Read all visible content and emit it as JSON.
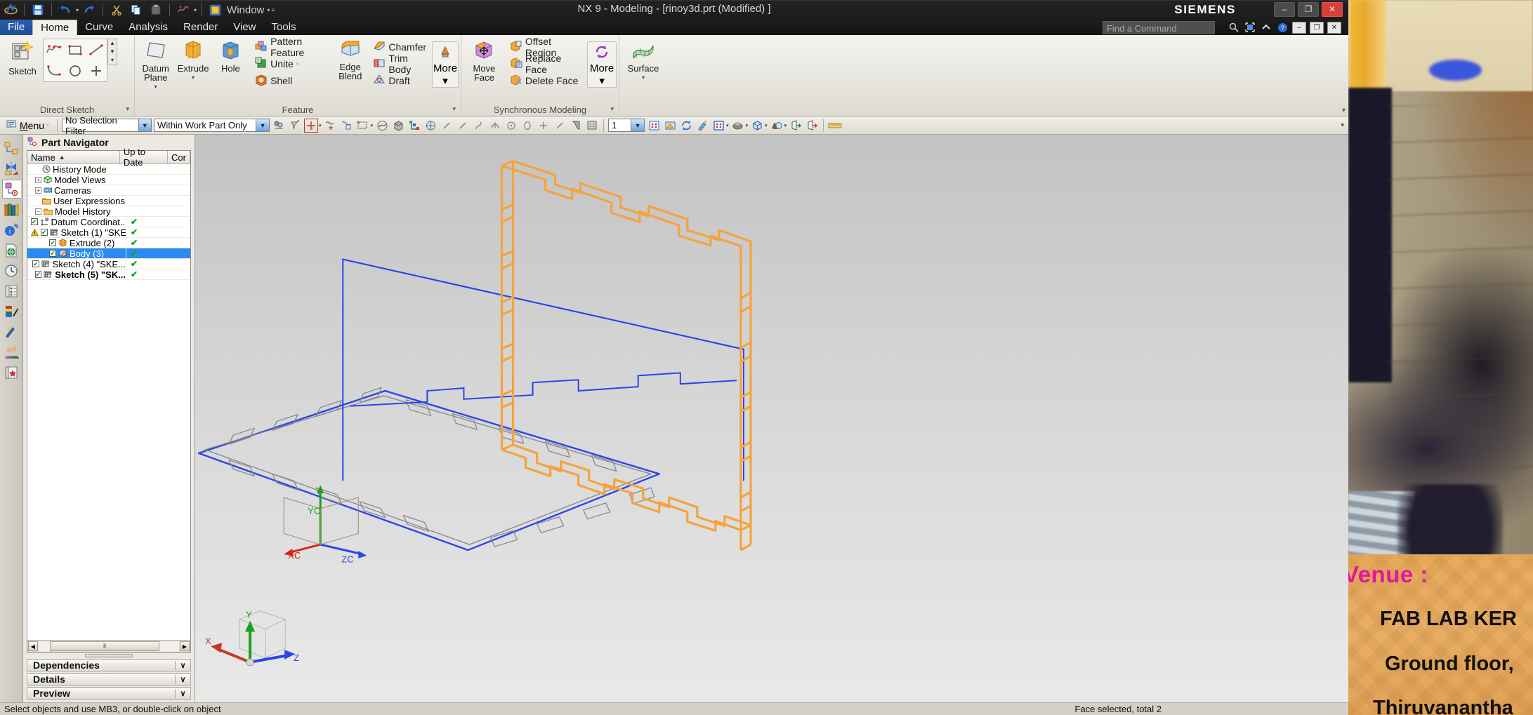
{
  "window": {
    "title": "NX 9 - Modeling - [rinoy3d.prt (Modified) ]",
    "brand": "SIEMENS",
    "minimize": "–",
    "restore": "❐",
    "close": "✕"
  },
  "quick_access": {
    "items": [
      {
        "name": "nx-logo-icon",
        "glyph": "❀"
      },
      {
        "name": "save-icon",
        "glyph": "ὋE"
      },
      {
        "name": "undo-icon",
        "glyph": "↶"
      },
      {
        "name": "undo-dropdown-icon",
        "glyph": "▾"
      },
      {
        "name": "redo-icon",
        "glyph": "↷"
      },
      {
        "name": "cut-icon",
        "glyph": "✂"
      },
      {
        "name": "copy-icon",
        "glyph": "⧉"
      },
      {
        "name": "paste-icon",
        "glyph": "ὌB"
      },
      {
        "name": "undo-list-icon",
        "glyph": "↫"
      },
      {
        "name": "undo-list-dropdown-icon",
        "glyph": "▾"
      }
    ],
    "window_label": "Window",
    "window_caret": "▾",
    "overflow_caret": "≡"
  },
  "tabs": [
    {
      "label": "File",
      "state": "file"
    },
    {
      "label": "Home",
      "state": "active"
    },
    {
      "label": "Curve",
      "state": "normal"
    },
    {
      "label": "Analysis",
      "state": "normal"
    },
    {
      "label": "Render",
      "state": "normal"
    },
    {
      "label": "View",
      "state": "normal"
    },
    {
      "label": "Tools",
      "state": "normal"
    }
  ],
  "search": {
    "placeholder": "Find a Command",
    "icons": [
      "search-icon",
      "fullscreen-icon",
      "collapse-ribbon-icon",
      "help-icon"
    ],
    "window_buttons": [
      "–",
      "❐",
      "✕"
    ]
  },
  "ribbon": {
    "groups": [
      {
        "title": "Direct Sketch",
        "caret": "▾",
        "sketch_button": {
          "label": "Sketch",
          "name": "sketch-button"
        },
        "grid_tools": [
          {
            "name": "studio-spline-icon",
            "glyph": "∿"
          },
          {
            "name": "rectangle-icon",
            "glyph": "▭"
          },
          {
            "name": "line-icon",
            "glyph": "╱"
          },
          {
            "name": "arc-icon",
            "glyph": "⤿"
          },
          {
            "name": "circle-icon",
            "glyph": "◯"
          },
          {
            "name": "point-icon",
            "glyph": "＋"
          }
        ],
        "scroll": [
          "▲",
          "▼",
          "▾"
        ]
      },
      {
        "title": "Feature",
        "caret": "▾",
        "big_buttons": [
          {
            "label": "Datum\nPlane",
            "name": "datum-plane-button",
            "caret": "▾"
          },
          {
            "label": "Extrude",
            "name": "extrude-button",
            "caret": "▾"
          },
          {
            "label": "Hole",
            "name": "hole-button",
            "caret": ""
          }
        ],
        "small_buttons_1": [
          {
            "label": "Pattern Feature",
            "name": "pattern-feature-button",
            "caret": ""
          },
          {
            "label": "Unite",
            "name": "unite-button",
            "caret": "▾"
          },
          {
            "label": "Shell",
            "name": "shell-button",
            "caret": ""
          }
        ],
        "edge_blend": {
          "label": "Edge\nBlend",
          "name": "edge-blend-button"
        },
        "small_buttons_2": [
          {
            "label": "Chamfer",
            "name": "chamfer-button"
          },
          {
            "label": "Trim Body",
            "name": "trim-body-button"
          },
          {
            "label": "Draft",
            "name": "draft-button"
          }
        ],
        "more": {
          "label": "More",
          "caret": "▾",
          "name": "feature-more-button"
        }
      },
      {
        "title": "Synchronous Modeling",
        "caret": "▾",
        "move_face": {
          "label": "Move\nFace",
          "name": "move-face-button"
        },
        "small_buttons": [
          {
            "label": "Offset Region",
            "name": "offset-region-button"
          },
          {
            "label": "Replace Face",
            "name": "replace-face-button"
          },
          {
            "label": "Delete Face",
            "name": "delete-face-button"
          }
        ],
        "more": {
          "label": "More",
          "caret": "▾",
          "name": "synchronous-more-button"
        }
      },
      {
        "title": "",
        "surface": {
          "label": "Surface",
          "caret": "▾",
          "name": "surface-button"
        }
      }
    ]
  },
  "selection_bar": {
    "menu_label": "Menu",
    "menu_caret": "▾",
    "filter_combo": {
      "value": "No Selection Filter",
      "name": "selection-filter-combo"
    },
    "scope_combo": {
      "value": "Within Work Part Only",
      "name": "selection-scope-combo"
    },
    "layer_value": "1",
    "icons": [
      "select-general-icon",
      "select-feature-icon",
      "snap-point-icon",
      "snap-point-dropdown-icon",
      "point-on-curve-icon",
      "intersection-point-icon",
      "rectangle-select-icon",
      "rectangle-select-dropdown-icon",
      "face-icon",
      "solid-body-icon",
      "datum-icon",
      "coordinate-icon",
      "edge-icon",
      "curve-icon",
      "spline-icon",
      "arc-center-icon",
      "circle-icon",
      "ellipse-icon",
      "point-icon",
      "line-icon",
      "sheet-body-icon",
      "mesh-icon"
    ],
    "right_icons": [
      "zoom-fit-icon",
      "render-style-icon",
      "refresh-icon",
      "highlight-icon",
      "layer-settings-icon",
      "layer-dropdown-icon",
      "shading-icon",
      "shading-dropdown-icon",
      "orient-view-icon",
      "orient-dropdown-icon",
      "color-icon",
      "color-dropdown-icon",
      "move-to-layer-icon",
      "copy-to-layer-icon",
      "measure-icon"
    ]
  },
  "resource_bar": {
    "items": [
      {
        "name": "assembly-navigator-icon",
        "glyph": "⬚",
        "active": false
      },
      {
        "name": "constraint-navigator-icon",
        "glyph": "⋈",
        "active": false
      },
      {
        "name": "part-navigator-icon",
        "glyph": "⬡",
        "active": true
      },
      {
        "name": "reuse-library-icon",
        "glyph": "█",
        "active": false
      },
      {
        "name": "hd3d-tools-icon",
        "glyph": "ⓘ",
        "active": false
      },
      {
        "name": "web-browser-icon",
        "glyph": "ἱ0",
        "active": false
      },
      {
        "name": "history-icon",
        "glyph": "ὕ4",
        "active": false
      },
      {
        "name": "system-materials-icon",
        "glyph": "▤",
        "active": false
      },
      {
        "name": "system-scene-icon",
        "glyph": "ἰ8",
        "active": false
      },
      {
        "name": "system-visual-icon",
        "glyph": "✨",
        "active": false
      },
      {
        "name": "roles-icon",
        "glyph": "὆5",
        "active": false
      },
      {
        "name": "favorites-icon",
        "glyph": "♡",
        "active": false
      }
    ]
  },
  "part_navigator": {
    "title": "Part Navigator",
    "title_icon": "part-navigator-icon",
    "columns": [
      {
        "label": "Name",
        "sort": "▲"
      },
      {
        "label": "Up to Date",
        "sort": ""
      },
      {
        "label": "Cor",
        "sort": ""
      }
    ],
    "rows": [
      {
        "indent": 1,
        "expander": "",
        "checkbox": "",
        "icon": "clock-icon",
        "label": "History Mode",
        "uptodate": "",
        "selected": false,
        "bold": false,
        "warn": false
      },
      {
        "indent": 0,
        "expander": "+",
        "checkbox": "",
        "icon": "model-views-icon",
        "label": "Model Views",
        "uptodate": "",
        "selected": false,
        "bold": false,
        "warn": false
      },
      {
        "indent": 0,
        "expander": "+",
        "checkbox": "",
        "icon": "camera-icon",
        "label": "Cameras",
        "uptodate": "",
        "selected": false,
        "bold": false,
        "warn": false
      },
      {
        "indent": 1,
        "expander": "",
        "checkbox": "",
        "icon": "folder-icon",
        "label": "User Expressions",
        "uptodate": "",
        "selected": false,
        "bold": false,
        "warn": false
      },
      {
        "indent": 0,
        "expander": "−",
        "checkbox": "",
        "icon": "folder-icon",
        "label": "Model History",
        "uptodate": "",
        "selected": false,
        "bold": false,
        "warn": false
      },
      {
        "indent": 2,
        "expander": "",
        "checkbox": "✔",
        "icon": "datum-csys-icon",
        "label": "Datum Coordinat...",
        "uptodate": "✔",
        "selected": false,
        "bold": false,
        "warn": false
      },
      {
        "indent": 2,
        "expander": "",
        "checkbox": "✔",
        "icon": "sketch-icon",
        "label": "Sketch (1) \"SKE...",
        "uptodate": "✔",
        "selected": false,
        "bold": false,
        "warn": true
      },
      {
        "indent": 2,
        "expander": "",
        "checkbox": "✔",
        "icon": "extrude-icon",
        "label": "Extrude (2)",
        "uptodate": "✔",
        "selected": false,
        "bold": false,
        "warn": false
      },
      {
        "indent": 2,
        "expander": "",
        "checkbox": "✔",
        "icon": "body-icon",
        "label": "Body (3)",
        "uptodate": "✔",
        "selected": true,
        "bold": false,
        "warn": false
      },
      {
        "indent": 2,
        "expander": "",
        "checkbox": "✔",
        "icon": "sketch-icon",
        "label": "Sketch (4) \"SKE...",
        "uptodate": "✔",
        "selected": false,
        "bold": false,
        "warn": false
      },
      {
        "indent": 2,
        "expander": "",
        "checkbox": "✔",
        "icon": "sketch-icon",
        "label": "Sketch (5) \"SK...",
        "uptodate": "✔",
        "selected": false,
        "bold": true,
        "warn": false
      }
    ],
    "hscroll": {
      "left": "◀",
      "right": "▶",
      "grip": "⫴"
    },
    "sections": [
      {
        "label": "Dependencies",
        "chevron": "∨"
      },
      {
        "label": "Details",
        "chevron": "∨"
      },
      {
        "label": "Preview",
        "chevron": "∨"
      }
    ]
  },
  "viewport": {
    "wcs_labels": {
      "x": "XC",
      "y": "YC",
      "z": "ZC"
    },
    "triad_labels": {
      "x": "X",
      "y": "Y",
      "z": "Z"
    },
    "colors": {
      "selected_body": "#f5a33c",
      "curve_blue": "#2a45e8",
      "edge_gray": "#8a8a8a",
      "axis_x": "#d8261c",
      "axis_y": "#1aa01a",
      "axis_z": "#2a45e8"
    }
  },
  "status_bar": {
    "left": "Select objects and use MB3, or double-click on object",
    "right": "Face selected, total 2"
  },
  "desktop_background": {
    "venue": "Venue :",
    "line1": "FAB LAB KER",
    "line2": "Ground floor,",
    "line3": "Thiruvanantha"
  }
}
